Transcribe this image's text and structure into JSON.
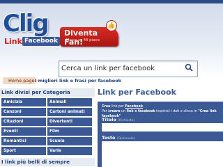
{
  "logo": {
    "main": "Clig",
    "link": "Link",
    "facebook": "Facebook"
  },
  "fan_badge": {
    "title": "Diventa Fan!",
    "subtitle": "Clicca su Mi piace"
  },
  "search": {
    "placeholder": "Cerca un link per facebook"
  },
  "breadcrumb": {
    "home": "Home page",
    "current": "I migliori link e frasi per facebook"
  },
  "sidebar": {
    "categories_title": "Link divisi per Categoria",
    "categories": [
      "Amicizia",
      "Animali",
      "Canzoni",
      "Cartoni animati",
      "Citazioni",
      "Divertenti",
      "Eventi",
      "Film",
      "Romantici",
      "Scuola",
      "Sport",
      "Varie"
    ],
    "best_title": "I link più belli di sempre"
  },
  "main": {
    "title": "Link per Facebook",
    "intro_1_bold": "Crea",
    "intro_1_rest": " link per ",
    "intro_1_link": "Facebook",
    "intro_1_end": ".",
    "intro_2_start": "Per ",
    "intro_2_bold1": "creare",
    "intro_2_mid": " un ",
    "intro_2_bold2": "link x facebook",
    "intro_2_rest": " inserisci i dati e clicca in ",
    "intro_2_quote": "\"Crea link facebook\"",
    "field_title_label": "Titolo",
    "field_title_hint": "(Richiesto)",
    "field_text_label": "Testo",
    "field_text_hint": "(Opzionale)"
  },
  "colors": {
    "brand_blue": "#3b5a95",
    "header_dark": "#2c4b86",
    "accent_red": "#d9221b"
  }
}
